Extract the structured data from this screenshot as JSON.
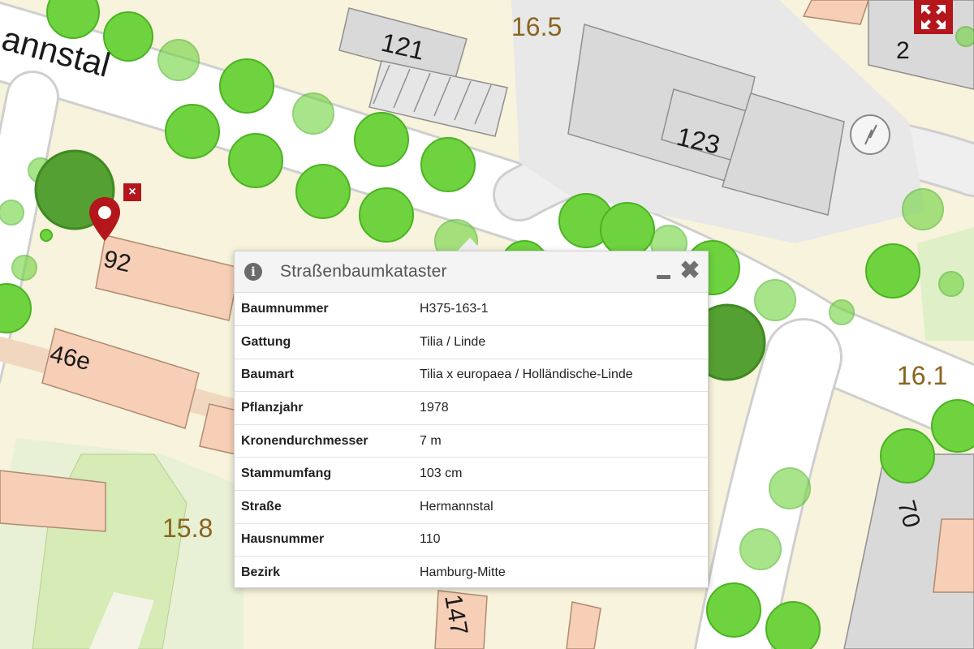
{
  "map": {
    "street_label": "annstal",
    "house_numbers": [
      "121",
      "123",
      "2",
      "92",
      "46e",
      "70",
      "147"
    ],
    "height_labels": [
      "16.5",
      "16.1",
      "15.8"
    ],
    "colors": {
      "background": "#f7f3dc",
      "road": "#ffffff",
      "road_casing": "#cfcfcf",
      "building": "#d9d9d9",
      "building_stroke": "#8f8f8f",
      "residential_building": "#f6cfb6",
      "park": "#d6ebb5",
      "tree_fill": "#6ed33e",
      "tree_stroke": "#4ab322",
      "tree_selected": "#55a032",
      "accent": "#b4161c"
    }
  },
  "controls": {
    "fullscreen_icon": "expand-arrows-icon",
    "marker_close_icon": "close-icon",
    "marker_icon": "map-pin-icon"
  },
  "popup": {
    "title": "Straßenbaumkataster",
    "info_icon": "i",
    "close_icon": "✖",
    "rows": [
      {
        "key": "Baumnummer",
        "value": "H375-163-1"
      },
      {
        "key": "Gattung",
        "value": "Tilia / Linde"
      },
      {
        "key": "Baumart",
        "value": "Tilia x europaea / Holländische-Linde"
      },
      {
        "key": "Pflanzjahr",
        "value": "1978"
      },
      {
        "key": "Kronendurchmesser",
        "value": "7 m"
      },
      {
        "key": "Stammumfang",
        "value": "103 cm"
      },
      {
        "key": "Straße",
        "value": "Hermannstal"
      },
      {
        "key": "Hausnummer",
        "value": "110"
      },
      {
        "key": "Bezirk",
        "value": "Hamburg-Mitte"
      }
    ]
  }
}
